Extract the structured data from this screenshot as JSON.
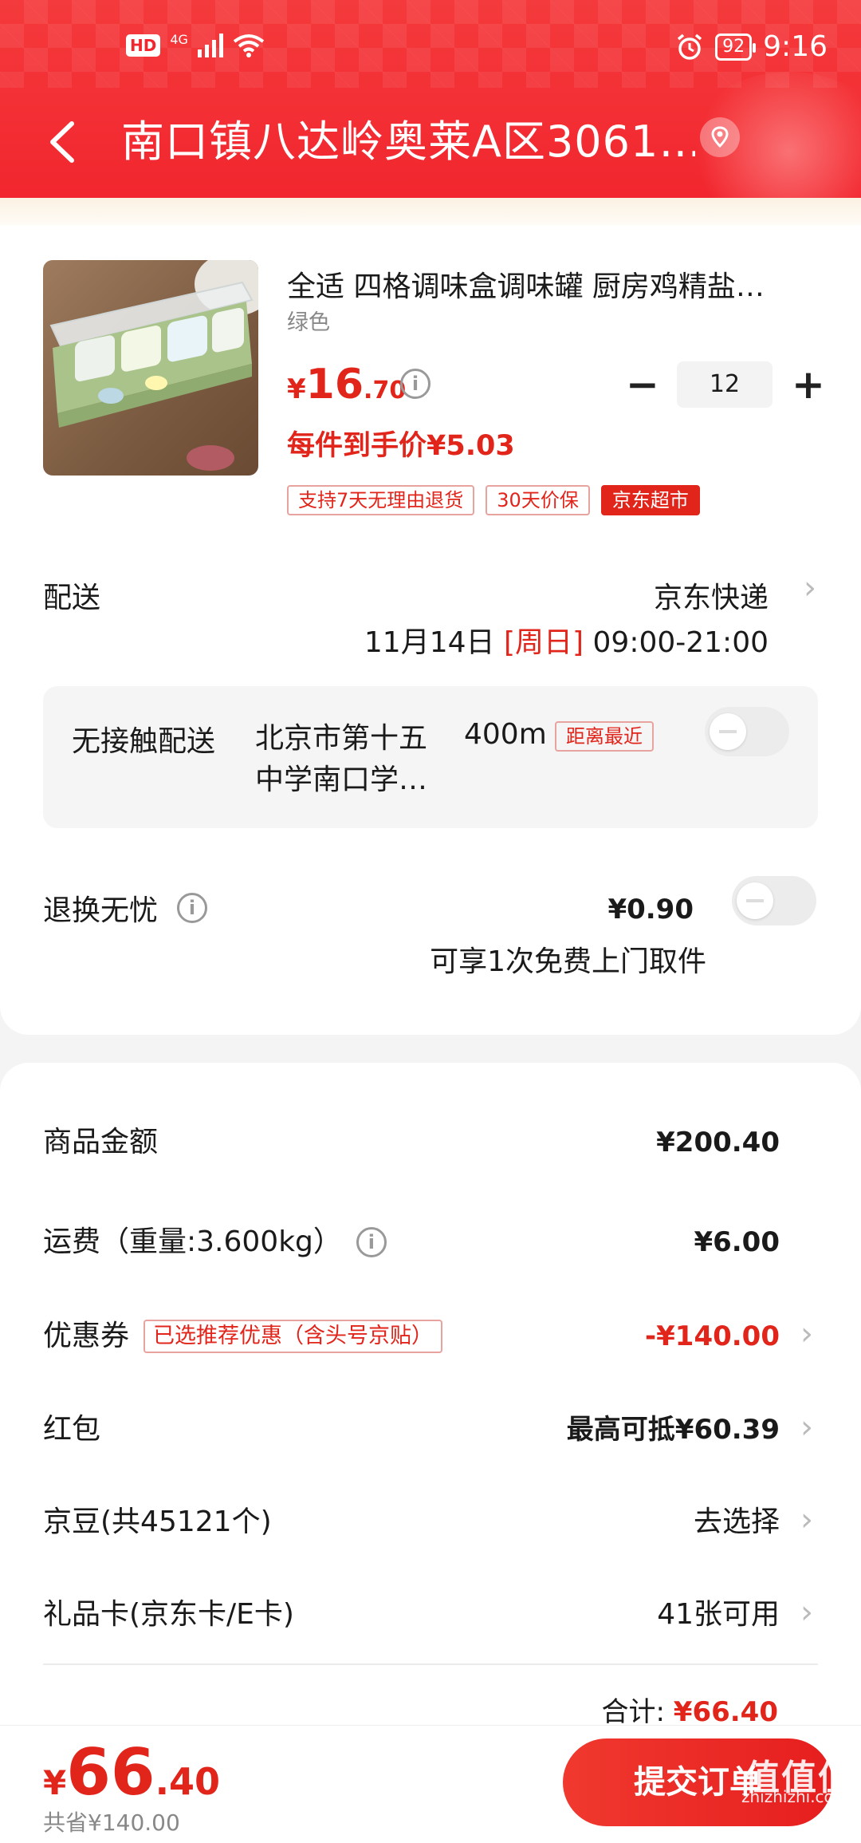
{
  "status_bar": {
    "hd": "HD",
    "network": "4G",
    "battery": "92",
    "time": "9:16"
  },
  "nav": {
    "address": "南口镇八达岭奥莱A区3061…"
  },
  "product": {
    "title": "全适 四格调味盒调味罐 厨房鸡精盐…",
    "spec": "绿色",
    "price_symbol": "¥",
    "price_int": "16",
    "price_dec": ".70",
    "info_glyph": "i",
    "quantity": "12",
    "minus": "−",
    "plus": "+",
    "unit_price": "每件到手价¥5.03",
    "tags": [
      "支持7天无理由退货",
      "30天价保",
      "京东超市"
    ]
  },
  "delivery": {
    "label": "配送",
    "method": "京东快递",
    "date": "11月14日",
    "day": "[周日]",
    "window": "09:00-21:00"
  },
  "contactless": {
    "label": "无接触配送",
    "location": "北京市第十五中学南口学…",
    "distance": "400m",
    "tag": "距离最近"
  },
  "return_service": {
    "label": "退换无忧",
    "price": "¥0.90",
    "desc": "可享1次免费上门取件"
  },
  "summary": {
    "rows": [
      {
        "label": "商品金额",
        "value": "¥200.40"
      },
      {
        "label": "运费（重量:3.600kg）",
        "value": "¥6.00"
      },
      {
        "label": "优惠券",
        "tag": "已选推荐优惠（含头号京贴）",
        "value": "-¥140.00"
      },
      {
        "label": "红包",
        "value": "最高可抵¥60.39"
      },
      {
        "label": "京豆(共45121个)",
        "value": "去选择"
      },
      {
        "label": "礼品卡(京东卡/E卡)",
        "value": "41张可用"
      }
    ],
    "subtotal_label": "合计:",
    "subtotal_value": "¥66.40"
  },
  "bottom": {
    "total_symbol": "¥",
    "total_int": "66",
    "total_dec": ".40",
    "saved": "共省¥140.00",
    "submit": "提交订单"
  },
  "watermark": {
    "brand": "值值值",
    "site": "zhizhizhi.com"
  },
  "colors": {
    "brand_red": "#e1251b",
    "header_red": "#f2262e"
  }
}
